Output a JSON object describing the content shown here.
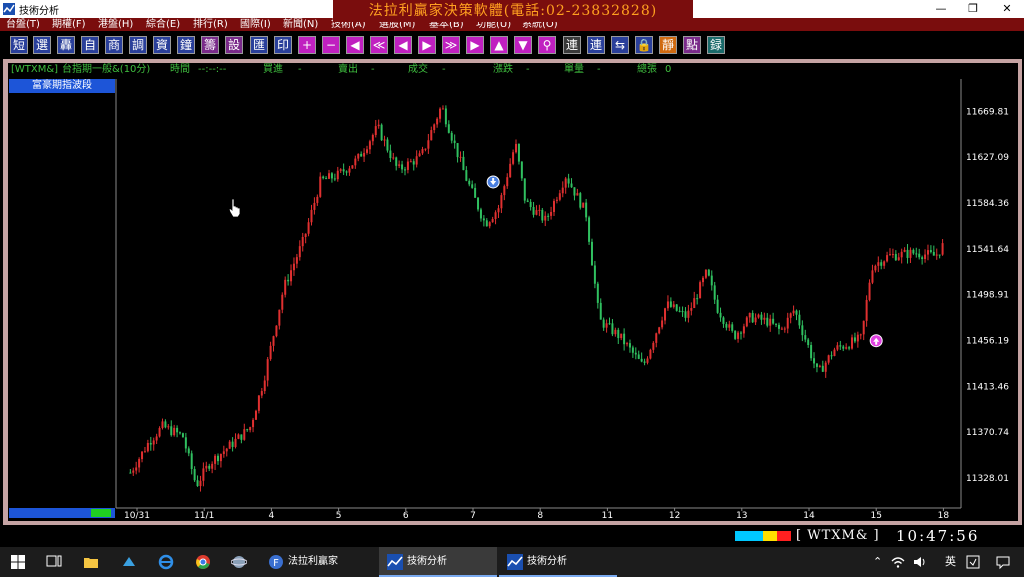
{
  "window": {
    "title": "技術分析",
    "min": "—",
    "max": "❐",
    "close": "✕"
  },
  "menu": [
    "台盤(T)",
    "期權(F)",
    "港盤(H)",
    "綜合(E)",
    "排行(R)",
    "國際(I)",
    "新聞(N)",
    "技術(A)",
    "選股(M)",
    "基本(B)",
    "功能(U)",
    "系統(O)"
  ],
  "banner": "法拉利贏家決策軟體(電話:02-23832828)",
  "toolbar": {
    "glyphs": [
      "短",
      "選",
      "轟",
      "自",
      "商",
      "調",
      "資",
      "鐘",
      "籌",
      "設",
      "匯",
      "印",
      "+",
      "−",
      "◀",
      "≪",
      "◀",
      "▶",
      "≫",
      "▶",
      "▲",
      "▼",
      "⚲",
      "連",
      "連",
      "⇆",
      "🔒",
      "靜",
      "點",
      "録"
    ]
  },
  "info": {
    "code": "[WTXM&]",
    "name": "台指期一般&(10分)",
    "time_label": "時間",
    "time_value": "--:--:--",
    "bid_label": "買進",
    "bid_value": "-",
    "ask_label": "賣出",
    "ask_value": "-",
    "deal_label": "成交",
    "deal_value": "-",
    "change_label": "漲跌",
    "change_value": "-",
    "vol_label": "單量",
    "vol_value": "-",
    "total_label": "總張",
    "total_value": "0"
  },
  "indicator_label": "富豪期指波段",
  "status": {
    "code": "WTXM&",
    "time": "10:47:56"
  },
  "colors": {
    "up": "#e03030",
    "down": "#30c060",
    "strip": [
      "#00c8ff",
      "#00c8ff",
      "#ffe000",
      "#ff2020"
    ]
  },
  "taskbar": {
    "items": [
      {
        "label": "法拉利贏家",
        "icon": "ferrari-app-icon"
      },
      {
        "label": "技術分析",
        "icon": "chart-app-icon"
      },
      {
        "label": "技術分析",
        "icon": "chart-app-icon"
      }
    ],
    "ime": "英"
  },
  "chart_data": {
    "type": "candlestick",
    "ylabels": [
      "11669.81",
      "11627.09",
      "11584.36",
      "11541.64",
      "11498.91",
      "11456.19",
      "11413.46",
      "11370.74",
      "11328.01"
    ],
    "xlabels": [
      "10/31",
      "11/1",
      "4",
      "5",
      "6",
      "7",
      "8",
      "11",
      "12",
      "13",
      "14",
      "15",
      "18"
    ],
    "ylim": [
      11300,
      11700
    ],
    "markers": [
      {
        "type": "sell-arrow",
        "x_index": 5.3,
        "price": 11604
      },
      {
        "type": "buy-arrow",
        "x_index": 11.0,
        "price": 11456
      }
    ],
    "path": [
      [
        0.02,
        11333
      ],
      [
        0.3,
        11362
      ],
      [
        0.5,
        11376
      ],
      [
        0.8,
        11367
      ],
      [
        1.0,
        11321
      ],
      [
        1.2,
        11342
      ],
      [
        1.5,
        11358
      ],
      [
        1.8,
        11375
      ],
      [
        2.0,
        11418
      ],
      [
        2.3,
        11505
      ],
      [
        2.6,
        11550
      ],
      [
        2.85,
        11605
      ],
      [
        3.1,
        11610
      ],
      [
        3.4,
        11625
      ],
      [
        3.7,
        11655
      ],
      [
        4.0,
        11615
      ],
      [
        4.35,
        11628
      ],
      [
        4.65,
        11675
      ],
      [
        5.0,
        11610
      ],
      [
        5.3,
        11565
      ],
      [
        5.5,
        11580
      ],
      [
        5.75,
        11640
      ],
      [
        5.9,
        11585
      ],
      [
        6.2,
        11568
      ],
      [
        6.5,
        11610
      ],
      [
        6.8,
        11575
      ],
      [
        7.0,
        11475
      ],
      [
        7.3,
        11460
      ],
      [
        7.65,
        11432
      ],
      [
        8.0,
        11490
      ],
      [
        8.3,
        11478
      ],
      [
        8.6,
        11520
      ],
      [
        8.75,
        11487
      ],
      [
        9.0,
        11460
      ],
      [
        9.25,
        11478
      ],
      [
        9.5,
        11474
      ],
      [
        9.7,
        11465
      ],
      [
        9.9,
        11485
      ],
      [
        10.1,
        11452
      ],
      [
        10.25,
        11425
      ],
      [
        10.5,
        11448
      ],
      [
        10.9,
        11458
      ],
      [
        11.05,
        11525
      ],
      [
        11.3,
        11535
      ],
      [
        11.7,
        11538
      ],
      [
        12.0,
        11535
      ],
      [
        12.15,
        11548
      ]
    ]
  }
}
